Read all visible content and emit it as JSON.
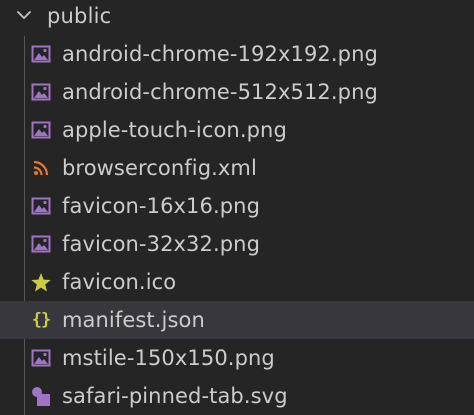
{
  "folder": {
    "name": "public",
    "expanded_icon": "chevron-down-icon"
  },
  "files": [
    {
      "name": "android-chrome-192x192.png",
      "icon": "image-icon"
    },
    {
      "name": "android-chrome-512x512.png",
      "icon": "image-icon"
    },
    {
      "name": "apple-touch-icon.png",
      "icon": "image-icon"
    },
    {
      "name": "browserconfig.xml",
      "icon": "rss-icon"
    },
    {
      "name": "favicon-16x16.png",
      "icon": "image-icon"
    },
    {
      "name": "favicon-32x32.png",
      "icon": "image-icon"
    },
    {
      "name": "favicon.ico",
      "icon": "star-icon"
    },
    {
      "name": "manifest.json",
      "icon": "json-braces-icon",
      "glyph": "{}",
      "selected": true
    },
    {
      "name": "mstile-150x150.png",
      "icon": "image-icon"
    },
    {
      "name": "safari-pinned-tab.svg",
      "icon": "svg-shapes-icon"
    }
  ],
  "colors": {
    "background": "#252526",
    "selected_row": "#37373d",
    "text": "#cccccc",
    "image_icon": "#a074c4",
    "rss_icon": "#e37933",
    "star_icon": "#cbcb41",
    "json_icon": "#cbcb41",
    "svg_icon": "#a074c4"
  }
}
